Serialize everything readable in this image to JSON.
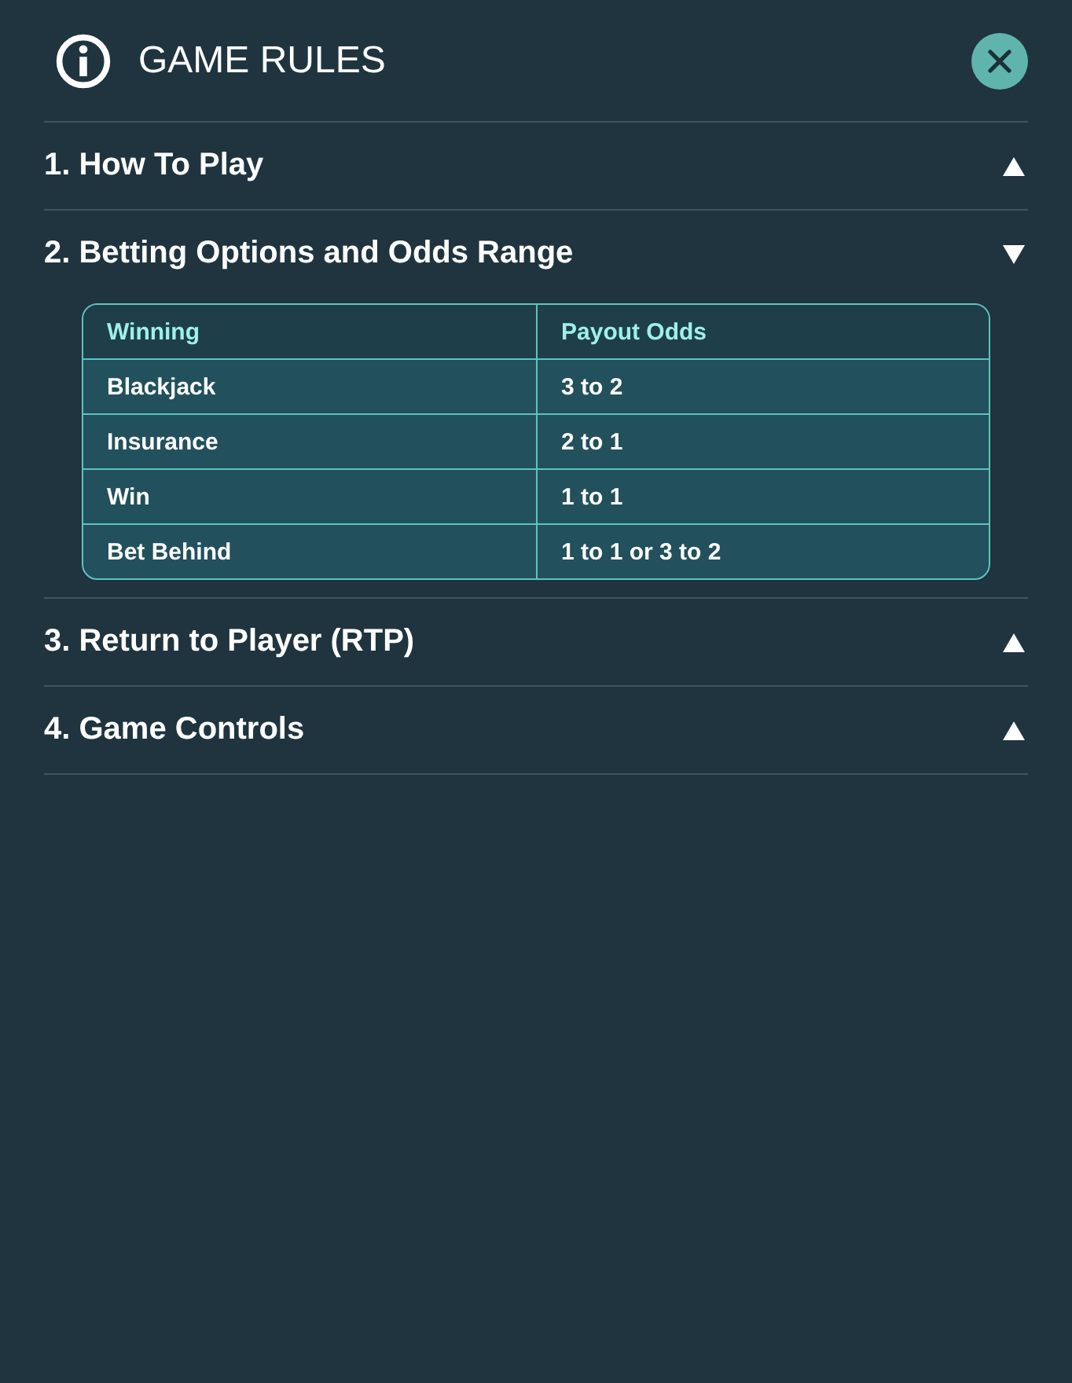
{
  "header": {
    "title": "GAME RULES"
  },
  "sections": [
    {
      "title": "1. How To Play",
      "expanded": false
    },
    {
      "title": "2. Betting Options and Odds Range",
      "expanded": true,
      "table": {
        "columns": [
          "Winning",
          "Payout Odds"
        ],
        "rows": [
          [
            "Blackjack",
            "3 to 2"
          ],
          [
            "Insurance",
            "2 to 1"
          ],
          [
            "Win",
            "1 to 1"
          ],
          [
            "Bet Behind",
            "1 to 1 or 3 to 2"
          ]
        ]
      }
    },
    {
      "title": "3. Return to Player (RTP)",
      "expanded": false
    },
    {
      "title": "4. Game Controls",
      "expanded": false
    }
  ]
}
